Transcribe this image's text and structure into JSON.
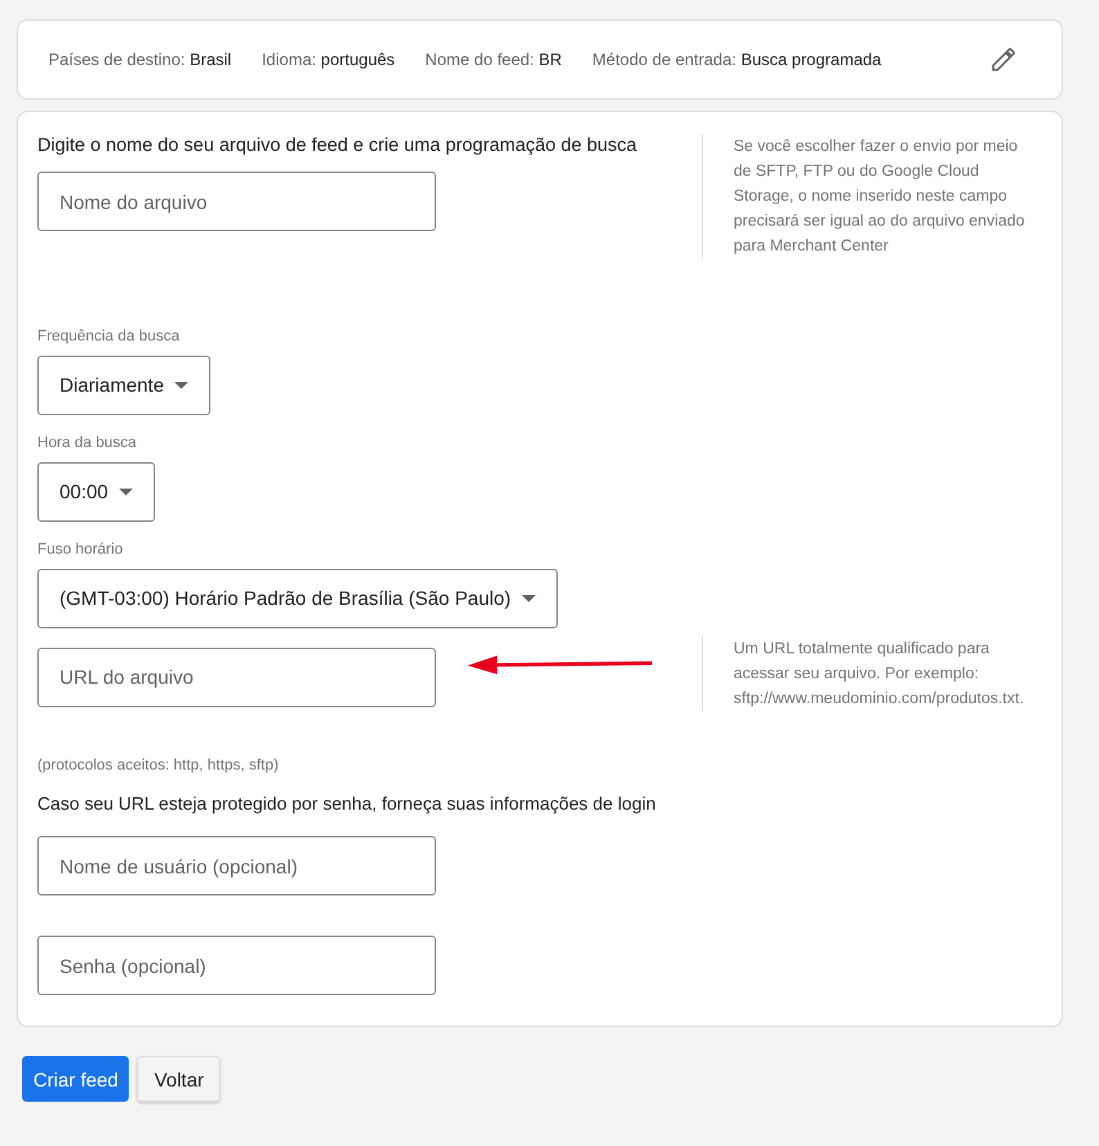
{
  "summary": {
    "items": [
      {
        "label": "Países de destino:",
        "value": "Brasil"
      },
      {
        "label": "Idioma:",
        "value": "português"
      },
      {
        "label": "Nome do feed:",
        "value": "BR"
      },
      {
        "label": "Método de entrada:",
        "value": "Busca programada"
      }
    ]
  },
  "file_section": {
    "heading": "Digite o nome do seu arquivo de feed e crie uma programação de busca",
    "file_field": {
      "placeholder": "Nome do arquivo"
    },
    "note": "Se você escolher fazer o envio por meio de SFTP, FTP ou do Google Cloud Storage, o nome inserido neste campo precisará ser igual ao do arquivo enviado para Merchant Center"
  },
  "schedule": [
    {
      "label": "Frequência da busca",
      "value": "Diariamente"
    },
    {
      "label": "Hora da busca",
      "value": "00:00"
    },
    {
      "label": "Fuso horário",
      "value": "(GMT-03:00) Horário Padrão de Brasília (São Paulo)"
    }
  ],
  "url_section": {
    "url_field": {
      "placeholder": "URL do arquivo"
    },
    "note": "Um URL totalmente qualificado para acessar seu arquivo. Por exemplo: sftp://www.meudominio.com/produtos.txt.",
    "protocols": "(protocolos aceitos: http, https, sftp)"
  },
  "login": {
    "heading": "Caso seu URL esteja protegido por senha, forneça suas informações de login",
    "fields": [
      {
        "placeholder": "Nome de usuário (opcional)"
      },
      {
        "placeholder": "Senha (opcional)"
      }
    ]
  },
  "buttons": [
    {
      "label": "Criar feed",
      "kind": "primary"
    },
    {
      "label": "Voltar",
      "kind": "secondary"
    }
  ]
}
